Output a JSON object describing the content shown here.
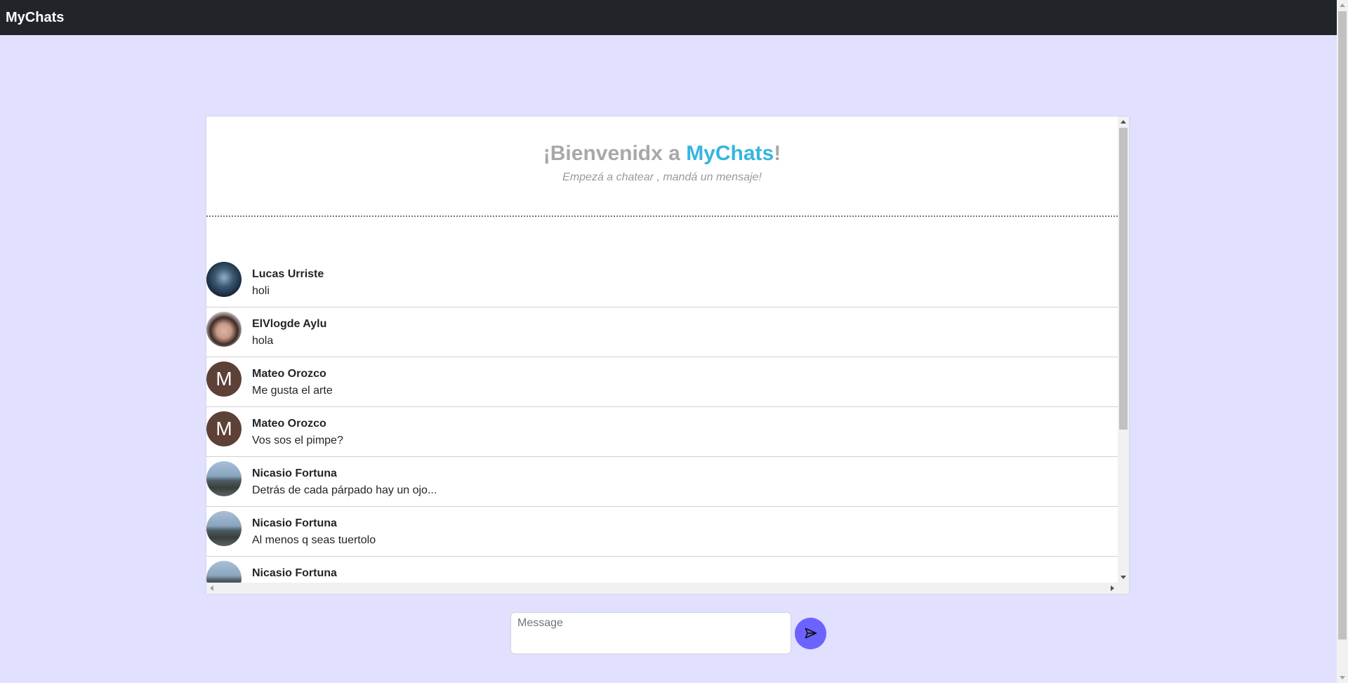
{
  "navbar": {
    "brand": "MyChats"
  },
  "welcome": {
    "title_prefix": "¡Bienvenidx a ",
    "title_accent": "MyChats",
    "title_suffix": "!",
    "subtitle": "Empezá a chatear , mandá un mensaje!"
  },
  "messages": [
    {
      "name": "Lucas Urriste",
      "text": "holi",
      "avatar": "photo"
    },
    {
      "name": "ElVlogde Aylu",
      "text": "hola",
      "avatar": "photo"
    },
    {
      "name": "Mateo Orozco",
      "text": "Me gusta el arte",
      "avatar": "M"
    },
    {
      "name": "Mateo Orozco",
      "text": "Vos sos el pimpe?",
      "avatar": "M"
    },
    {
      "name": "Nicasio Fortuna",
      "text": "Detrás de cada párpado hay un ojo...",
      "avatar": "photo"
    },
    {
      "name": "Nicasio Fortuna",
      "text": "Al menos q seas tuertolo",
      "avatar": "photo"
    },
    {
      "name": "Nicasio Fortuna",
      "text": "",
      "avatar": "photo"
    }
  ],
  "composer": {
    "placeholder": "Message"
  },
  "colors": {
    "page_bg": "#e1e0ff",
    "navbar_bg": "#212529",
    "accent": "#35b5e0",
    "send_button": "#6c63ff",
    "letter_avatar": "#5d4037"
  }
}
